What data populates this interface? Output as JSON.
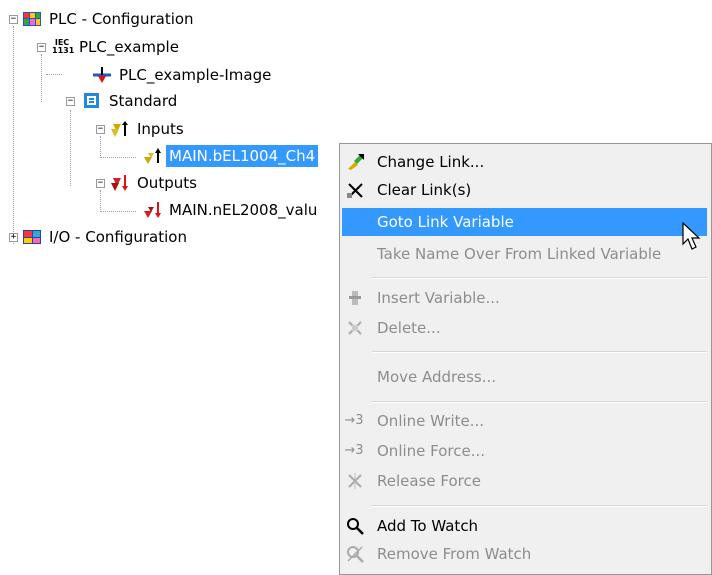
{
  "tree": {
    "plc_config": "PLC - Configuration",
    "plc_example": "PLC_example",
    "plc_image": "PLC_example-Image",
    "standard": "Standard",
    "inputs": "Inputs",
    "input_var": "MAIN.bEL1004_Ch4",
    "outputs": "Outputs",
    "output_var": "MAIN.nEL2008_valu",
    "io_config": "I/O - Configuration",
    "iec_badge": "IEC\n1131"
  },
  "menu": {
    "change_link": "Change Link...",
    "clear_link": "Clear Link(s)",
    "goto_link": "Goto Link Variable",
    "take_name": "Take Name Over From Linked Variable",
    "insert_var": "Insert Variable...",
    "delete": "Delete...",
    "move_address": "Move Address...",
    "online_write": "Online Write...",
    "online_force": "Online Force...",
    "release_force": "Release Force",
    "add_watch": "Add To Watch",
    "remove_watch": "Remove From Watch",
    "online_prefix": "→3"
  },
  "colors": {
    "selection": "#3399ff",
    "menu_bg": "#f0f0f0",
    "disabled_text": "#8d8d8d"
  }
}
